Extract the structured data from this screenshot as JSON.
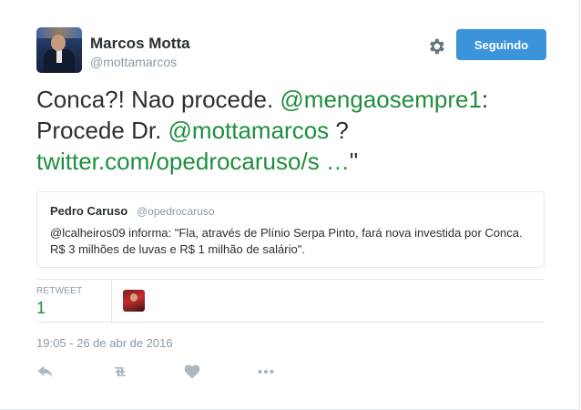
{
  "user": {
    "name": "Marcos Motta",
    "handle": "@mottamarcos"
  },
  "follow_button": {
    "label": "Seguindo",
    "color": "#3b94d9"
  },
  "tweet": {
    "text_1": "Conca?! Nao procede. ",
    "mention_1": "@mengaosempre1",
    "text_2": ": Procede Dr. ",
    "mention_2": "@mottamarcos",
    "text_3": " ? ",
    "link": "twitter.com/opedrocaruso/s …",
    "text_4": "\"",
    "link_color": "#1e8e3e"
  },
  "quoted": {
    "name": "Pedro Caruso",
    "handle": "@opedrocaruso",
    "text": "@lcalheiros09 informa: \"Fla, através de Plínio Serpa Pinto, fará nova investida por Conca. R$ 3 milhões de luvas e R$ 1 milhão de salário\"."
  },
  "stats": {
    "retweet_label": "RETWEET",
    "retweet_count": "1"
  },
  "timestamp": "19:05 - 26 de abr de 2016",
  "icons": [
    "gear-icon",
    "reply-icon",
    "retweet-icon",
    "like-icon",
    "more-icon"
  ]
}
